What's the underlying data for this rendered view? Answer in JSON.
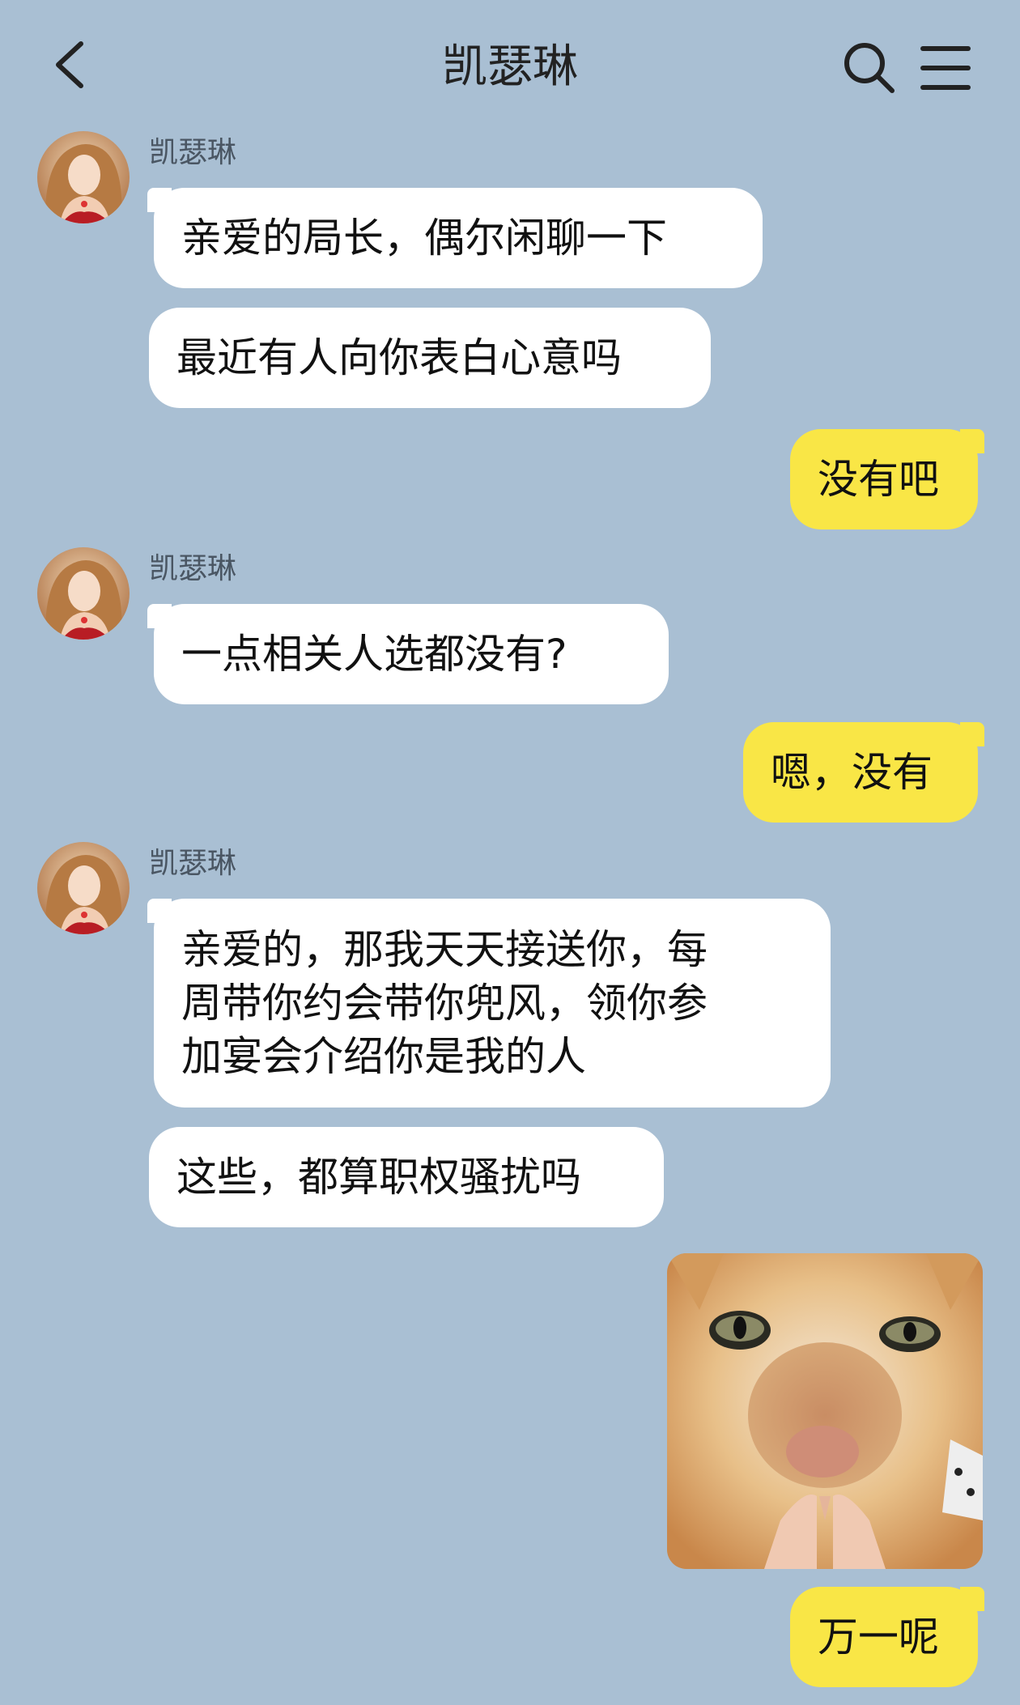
{
  "header": {
    "title": "凯瑟琳",
    "back_icon": "chevron-left-icon",
    "search_icon": "search-icon",
    "menu_icon": "menu-icon"
  },
  "colors": {
    "background": "#a9bfd3",
    "incoming_bubble": "#ffffff",
    "outgoing_bubble": "#f9e646"
  },
  "messages": [
    {
      "side": "in",
      "sender": "凯瑟琳",
      "text": "亲爱的局长，偶尔闲聊一下"
    },
    {
      "side": "in",
      "text": "最近有人向你表白心意吗"
    },
    {
      "side": "out",
      "text": "没有吧"
    },
    {
      "side": "in",
      "sender": "凯瑟琳",
      "text": "一点相关人选都没有?"
    },
    {
      "side": "out",
      "text": "嗯，没有"
    },
    {
      "side": "in",
      "sender": "凯瑟琳",
      "text": "亲爱的，那我天天接送你，每\n周带你约会带你兜风，领你参\n加宴会介绍你是我的人"
    },
    {
      "side": "in",
      "text": "这些，都算职权骚扰吗"
    },
    {
      "side": "out",
      "type": "sticker",
      "sticker": "cat-praying-hands-sticker"
    },
    {
      "side": "out",
      "text": "万一呢"
    }
  ]
}
